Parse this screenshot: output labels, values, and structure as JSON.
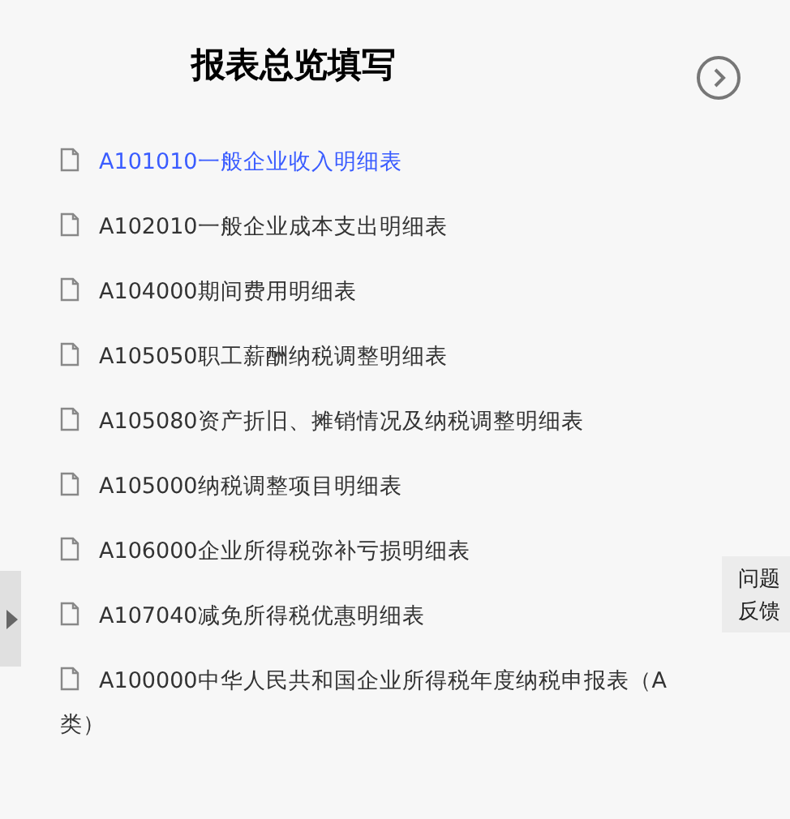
{
  "header": {
    "title": "报表总览填写"
  },
  "forms": [
    {
      "label": "A101010一般企业收入明细表",
      "selected": true
    },
    {
      "label": "A102010一般企业成本支出明细表",
      "selected": false
    },
    {
      "label": "A104000期间费用明细表",
      "selected": false
    },
    {
      "label": "A105050职工薪酬纳税调整明细表",
      "selected": false
    },
    {
      "label": "A105080资产折旧、摊销情况及纳税调整明细表",
      "selected": false
    },
    {
      "label": "A105000纳税调整项目明细表",
      "selected": false
    },
    {
      "label": "A106000企业所得税弥补亏损明细表",
      "selected": false
    },
    {
      "label": "A107040减免所得税优惠明细表",
      "selected": false
    },
    {
      "label": "A100000中华人民共和国企业所得税年度纳税申报表（A类）",
      "selected": false
    }
  ],
  "feedback": {
    "label": "问题反馈"
  }
}
